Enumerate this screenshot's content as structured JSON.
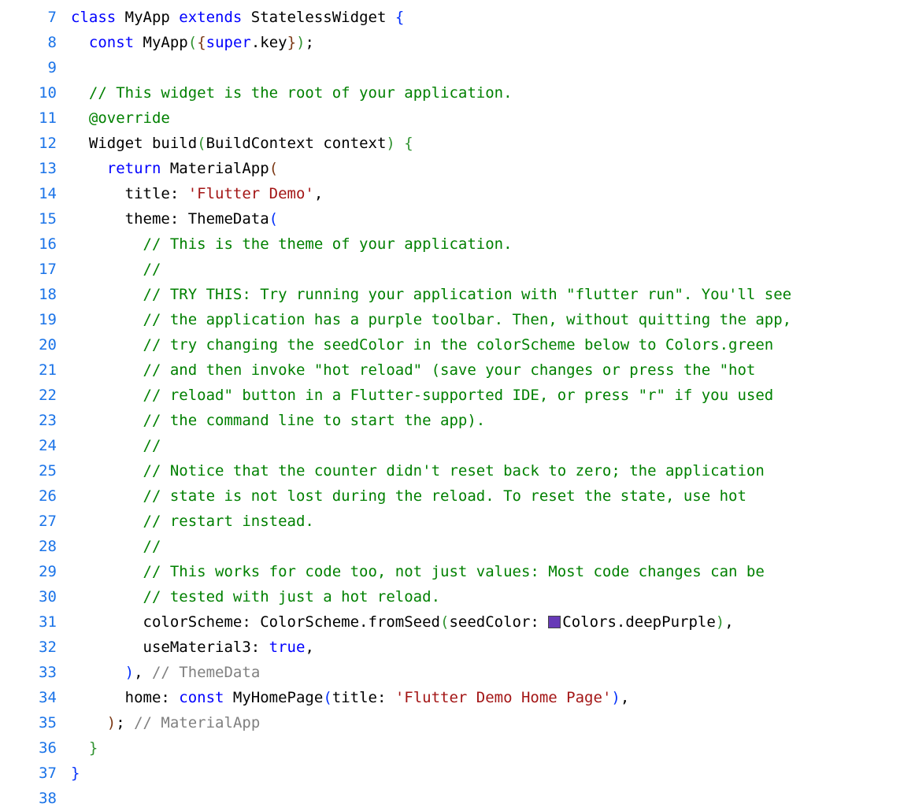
{
  "gutter": {
    "start": 7,
    "end": 38
  },
  "code": {
    "lines": [
      [
        {
          "t": "class ",
          "c": "kw"
        },
        {
          "t": "MyApp ",
          "c": "type"
        },
        {
          "t": "extends ",
          "c": "kw"
        },
        {
          "t": "StatelessWidget ",
          "c": "type"
        },
        {
          "t": "{",
          "c": "paren-h1"
        }
      ],
      [
        {
          "t": "  ",
          "c": ""
        },
        {
          "t": "const ",
          "c": "kw"
        },
        {
          "t": "MyApp",
          "c": "type"
        },
        {
          "t": "(",
          "c": "paren-h2"
        },
        {
          "t": "{",
          "c": "paren-h3"
        },
        {
          "t": "super",
          "c": "kw2"
        },
        {
          "t": ".key",
          "c": ""
        },
        {
          "t": "}",
          "c": "paren-h3"
        },
        {
          "t": ")",
          "c": "paren-h2"
        },
        {
          "t": ";",
          "c": ""
        }
      ],
      [],
      [
        {
          "t": "  ",
          "c": ""
        },
        {
          "t": "// This widget is the root of your application.",
          "c": "cmt"
        }
      ],
      [
        {
          "t": "  ",
          "c": ""
        },
        {
          "t": "@override",
          "c": "annot"
        }
      ],
      [
        {
          "t": "  Widget build",
          "c": ""
        },
        {
          "t": "(",
          "c": "paren-h2"
        },
        {
          "t": "BuildContext context",
          "c": ""
        },
        {
          "t": ")",
          "c": "paren-h2"
        },
        {
          "t": " ",
          "c": ""
        },
        {
          "t": "{",
          "c": "paren-h2"
        }
      ],
      [
        {
          "t": "    ",
          "c": ""
        },
        {
          "t": "return ",
          "c": "kw"
        },
        {
          "t": "MaterialApp",
          "c": ""
        },
        {
          "t": "(",
          "c": "paren-h3"
        }
      ],
      [
        {
          "t": "      title: ",
          "c": ""
        },
        {
          "t": "'Flutter Demo'",
          "c": "str"
        },
        {
          "t": ",",
          "c": ""
        }
      ],
      [
        {
          "t": "      theme: ThemeData",
          "c": ""
        },
        {
          "t": "(",
          "c": "paren-h1"
        }
      ],
      [
        {
          "t": "        ",
          "c": ""
        },
        {
          "t": "// This is the theme of your application.",
          "c": "cmt"
        }
      ],
      [
        {
          "t": "        ",
          "c": ""
        },
        {
          "t": "//",
          "c": "cmt"
        }
      ],
      [
        {
          "t": "        ",
          "c": ""
        },
        {
          "t": "// TRY THIS: Try running your application with \"flutter run\". You'll see",
          "c": "cmt"
        }
      ],
      [
        {
          "t": "        ",
          "c": ""
        },
        {
          "t": "// the application has a purple toolbar. Then, without quitting the app,",
          "c": "cmt"
        }
      ],
      [
        {
          "t": "        ",
          "c": ""
        },
        {
          "t": "// try changing the seedColor in the colorScheme below to Colors.green",
          "c": "cmt"
        }
      ],
      [
        {
          "t": "        ",
          "c": ""
        },
        {
          "t": "// and then invoke \"hot reload\" (save your changes or press the \"hot",
          "c": "cmt"
        }
      ],
      [
        {
          "t": "        ",
          "c": ""
        },
        {
          "t": "// reload\" button in a Flutter-supported IDE, or press \"r\" if you used",
          "c": "cmt"
        }
      ],
      [
        {
          "t": "        ",
          "c": ""
        },
        {
          "t": "// the command line to start the app).",
          "c": "cmt"
        }
      ],
      [
        {
          "t": "        ",
          "c": ""
        },
        {
          "t": "//",
          "c": "cmt"
        }
      ],
      [
        {
          "t": "        ",
          "c": ""
        },
        {
          "t": "// Notice that the counter didn't reset back to zero; the application",
          "c": "cmt"
        }
      ],
      [
        {
          "t": "        ",
          "c": ""
        },
        {
          "t": "// state is not lost during the reload. To reset the state, use hot",
          "c": "cmt"
        }
      ],
      [
        {
          "t": "        ",
          "c": ""
        },
        {
          "t": "// restart instead.",
          "c": "cmt"
        }
      ],
      [
        {
          "t": "        ",
          "c": ""
        },
        {
          "t": "//",
          "c": "cmt"
        }
      ],
      [
        {
          "t": "        ",
          "c": ""
        },
        {
          "t": "// This works for code too, not just values: Most code changes can be",
          "c": "cmt"
        }
      ],
      [
        {
          "t": "        ",
          "c": ""
        },
        {
          "t": "// tested with just a hot reload.",
          "c": "cmt"
        }
      ],
      [
        {
          "t": "        colorScheme: ColorScheme.fromSeed",
          "c": ""
        },
        {
          "t": "(",
          "c": "paren-h2"
        },
        {
          "t": "seedColor: ",
          "c": ""
        },
        {
          "swatch": "#673ab7"
        },
        {
          "t": "Colors.deepPurple",
          "c": ""
        },
        {
          "t": ")",
          "c": "paren-h2"
        },
        {
          "t": ",",
          "c": ""
        }
      ],
      [
        {
          "t": "        useMaterial3: ",
          "c": ""
        },
        {
          "t": "true",
          "c": "kw2"
        },
        {
          "t": ",",
          "c": ""
        }
      ],
      [
        {
          "t": "      ",
          "c": ""
        },
        {
          "t": ")",
          "c": "paren-h1"
        },
        {
          "t": ", ",
          "c": ""
        },
        {
          "t": "// ThemeData",
          "c": "grey-cmt"
        }
      ],
      [
        {
          "t": "      home: ",
          "c": ""
        },
        {
          "t": "const ",
          "c": "kw"
        },
        {
          "t": "MyHomePage",
          "c": ""
        },
        {
          "t": "(",
          "c": "paren-h1"
        },
        {
          "t": "title: ",
          "c": ""
        },
        {
          "t": "'Flutter Demo Home Page'",
          "c": "str"
        },
        {
          "t": ")",
          "c": "paren-h1"
        },
        {
          "t": ",",
          "c": ""
        }
      ],
      [
        {
          "t": "    ",
          "c": ""
        },
        {
          "t": ")",
          "c": "paren-h3"
        },
        {
          "t": "; ",
          "c": ""
        },
        {
          "t": "// MaterialApp",
          "c": "grey-cmt"
        }
      ],
      [
        {
          "t": "  ",
          "c": ""
        },
        {
          "t": "}",
          "c": "paren-h2"
        }
      ],
      [
        {
          "t": "}",
          "c": "paren-h1"
        }
      ],
      []
    ]
  },
  "colors": {
    "swatch": "#673ab7"
  }
}
